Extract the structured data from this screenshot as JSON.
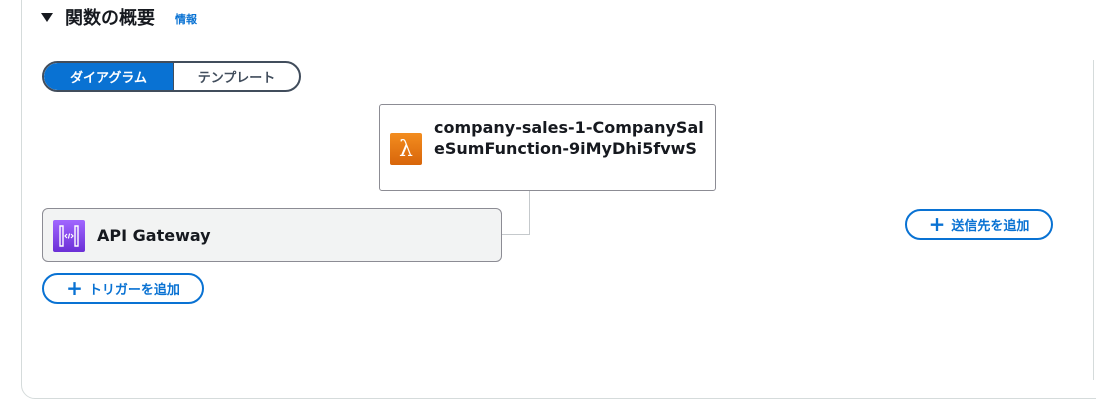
{
  "section": {
    "title": "関数の概要",
    "info_link": "情報"
  },
  "view_toggle": {
    "diagram_label": "ダイアグラム",
    "template_label": "テンプレート",
    "selected": "ダイアグラム"
  },
  "function": {
    "name": "company-sales-1-CompanySaleSumFunction-9iMyDhi5fvwS",
    "icon": "lambda-icon"
  },
  "trigger": {
    "label": "API Gateway",
    "icon": "api-gateway-icon"
  },
  "actions": {
    "add_trigger": "トリガーを追加",
    "add_destination": "送信先を追加"
  },
  "colors": {
    "accent": "#0972d3",
    "lambda_orange": "#e7760f",
    "api_gateway_purple": "#8c4fff"
  }
}
